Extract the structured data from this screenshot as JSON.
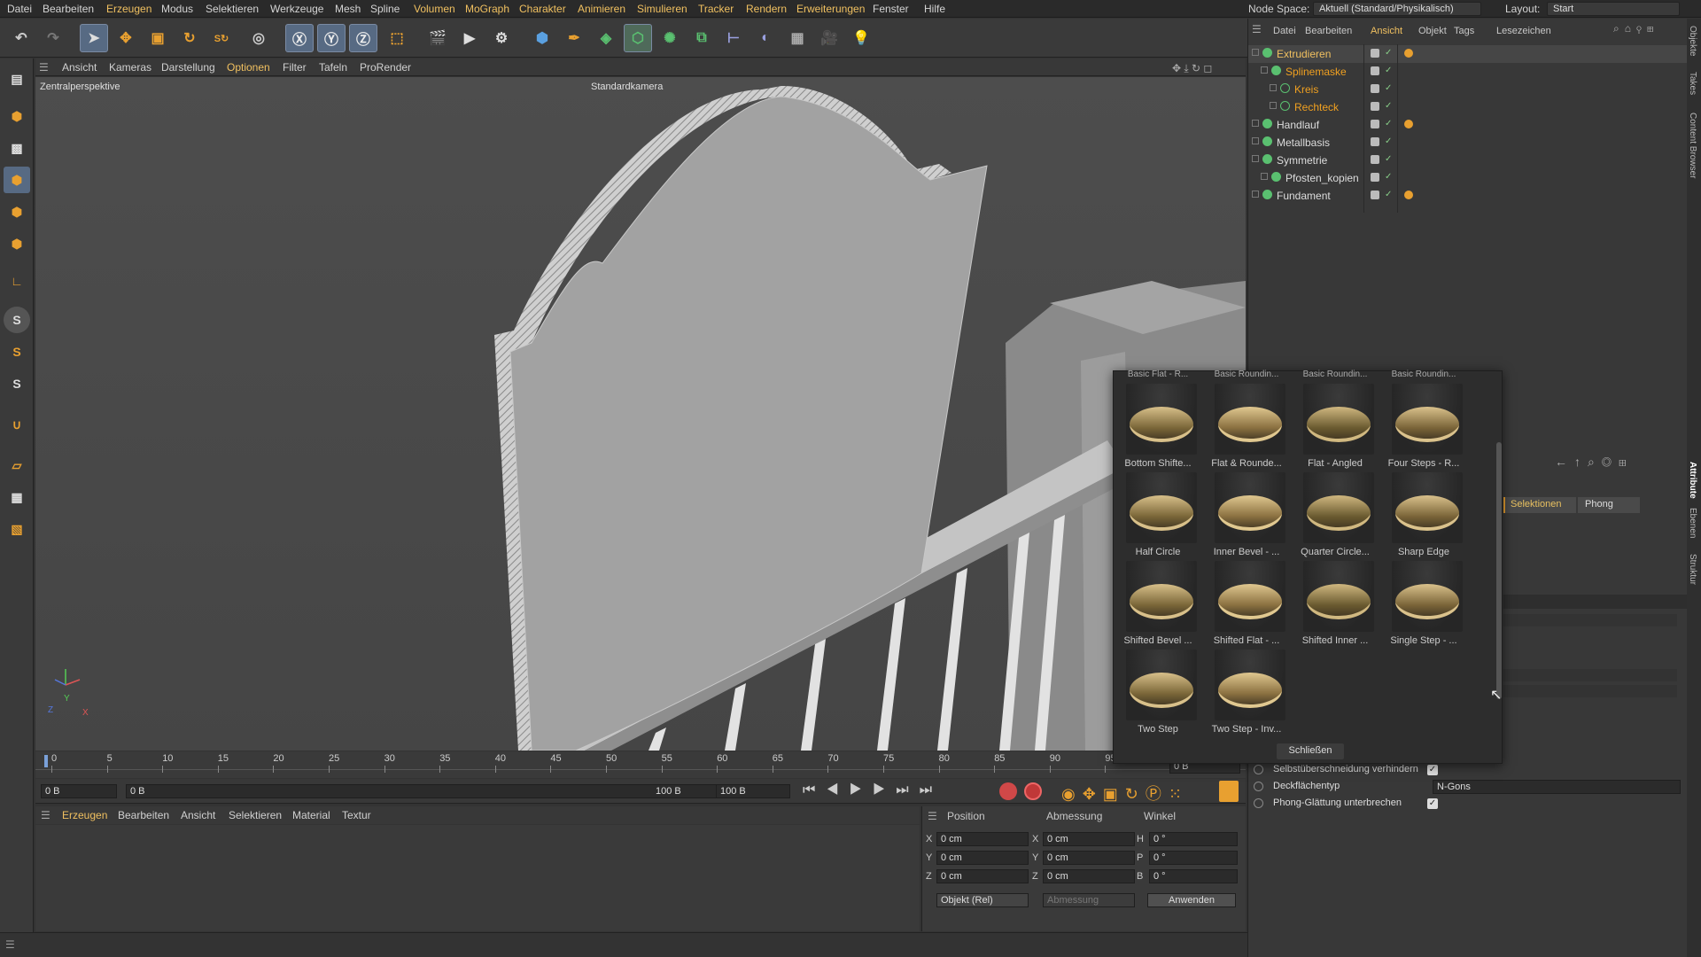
{
  "menu": [
    "Datei",
    "Bearbeiten",
    "Erzeugen",
    "Modus",
    "Selektieren",
    "Werkzeuge",
    "Mesh",
    "Spline",
    "Volumen",
    "MoGraph",
    "Charakter",
    "Animieren",
    "Simulieren",
    "Tracker",
    "Rendern",
    "Erweiterungen",
    "Fenster",
    "Hilfe"
  ],
  "menu_highlight_color": "#f0c060",
  "node_space": {
    "label": "Node Space:",
    "value": "Aktuell (Standard/Physikalisch)"
  },
  "layout": {
    "label": "Layout:",
    "value": "Start"
  },
  "viewport_menu": [
    "Ansicht",
    "Kameras",
    "Darstellung",
    "Optionen",
    "Filter",
    "Tafeln",
    "ProRender"
  ],
  "viewport": {
    "perspective": "Zentralperspektive",
    "camera": "Standardkamera"
  },
  "axis_labels": {
    "y": "Y",
    "z": "Z",
    "x": "X"
  },
  "timeline_ticks": [
    "0",
    "5",
    "10",
    "15",
    "20",
    "25",
    "30",
    "35",
    "40",
    "45",
    "50",
    "55",
    "60",
    "65",
    "70",
    "75",
    "80",
    "85",
    "90",
    "95"
  ],
  "timeline_end": "0 B",
  "transport": {
    "start": "0 B",
    "current": "0 B",
    "max": "100 B",
    "end": "100 B"
  },
  "material_menu": [
    "Erzeugen",
    "Bearbeiten",
    "Ansicht",
    "Selektieren",
    "Material",
    "Textur"
  ],
  "coords": {
    "headers": [
      "Position",
      "Abmessung",
      "Winkel"
    ],
    "rows": [
      {
        "axis": "X",
        "pos": "0 cm",
        "dim_axis": "X",
        "dim": "0 cm",
        "ang_axis": "H",
        "ang": "0 °"
      },
      {
        "axis": "Y",
        "pos": "0 cm",
        "dim_axis": "Y",
        "dim": "0 cm",
        "ang_axis": "P",
        "ang": "0 °"
      },
      {
        "axis": "Z",
        "pos": "0 cm",
        "dim_axis": "Z",
        "dim": "0 cm",
        "ang_axis": "B",
        "ang": "0 °"
      }
    ],
    "mode": "Objekt (Rel)",
    "dim_mode": "Abmessung",
    "apply": "Anwenden"
  },
  "object_manager": {
    "menu": [
      "Datei",
      "Bearbeiten",
      "Ansicht",
      "Objekt",
      "Tags",
      "Lesezeichen"
    ],
    "items": [
      {
        "name": "Extrudieren",
        "color": "#f0c060",
        "indent": 0,
        "icon": "extrude-icon"
      },
      {
        "name": "Splinemaske",
        "color": "#f0a020",
        "indent": 1,
        "icon": "splinemask-icon"
      },
      {
        "name": "Kreis",
        "color": "#f0a020",
        "indent": 2,
        "icon": "circle-icon"
      },
      {
        "name": "Rechteck",
        "color": "#f0a020",
        "indent": 2,
        "icon": "rectangle-icon"
      },
      {
        "name": "Handlauf",
        "color": "#dddddd",
        "indent": 0,
        "icon": "sweep-icon"
      },
      {
        "name": "Metallbasis",
        "color": "#dddddd",
        "indent": 0,
        "icon": "null-icon"
      },
      {
        "name": "Symmetrie",
        "color": "#dddddd",
        "indent": 0,
        "icon": "symmetry-icon"
      },
      {
        "name": "Pfosten_kopien",
        "color": "#dddddd",
        "indent": 1,
        "icon": "null-icon"
      },
      {
        "name": "Fundament",
        "color": "#dddddd",
        "indent": 0,
        "icon": "figure-icon"
      }
    ]
  },
  "side_tabs": [
    "Objekte",
    "Takes",
    "Content Browser",
    "Attribute",
    "Ebenen",
    "Struktur"
  ],
  "attributes": {
    "tabs": [
      "Selektionen",
      "Phong"
    ],
    "rows": [
      {
        "label": "Selbstüberschneidung verhindern",
        "checked": true
      },
      {
        "label": "Deckflächentyp",
        "value": "N-Gons"
      },
      {
        "label": "Phong-Glättung unterbrechen",
        "checked": true
      }
    ]
  },
  "bevel_popup": {
    "top_cut": [
      "Basic Flat - R...",
      "Basic Roundin...",
      "Basic Roundin...",
      "Basic Roundin..."
    ],
    "presets": [
      "Bottom Shifte...",
      "Flat & Rounde...",
      "Flat - Angled",
      "Four Steps - R...",
      "Half Circle",
      "Inner Bevel - ...",
      "Quarter Circle...",
      "Sharp Edge",
      "Shifted Bevel ...",
      "Shifted Flat - ...",
      "Shifted Inner ...",
      "Single Step - ...",
      "Two Step",
      "Two Step - Inv..."
    ],
    "close": "Schließen"
  }
}
